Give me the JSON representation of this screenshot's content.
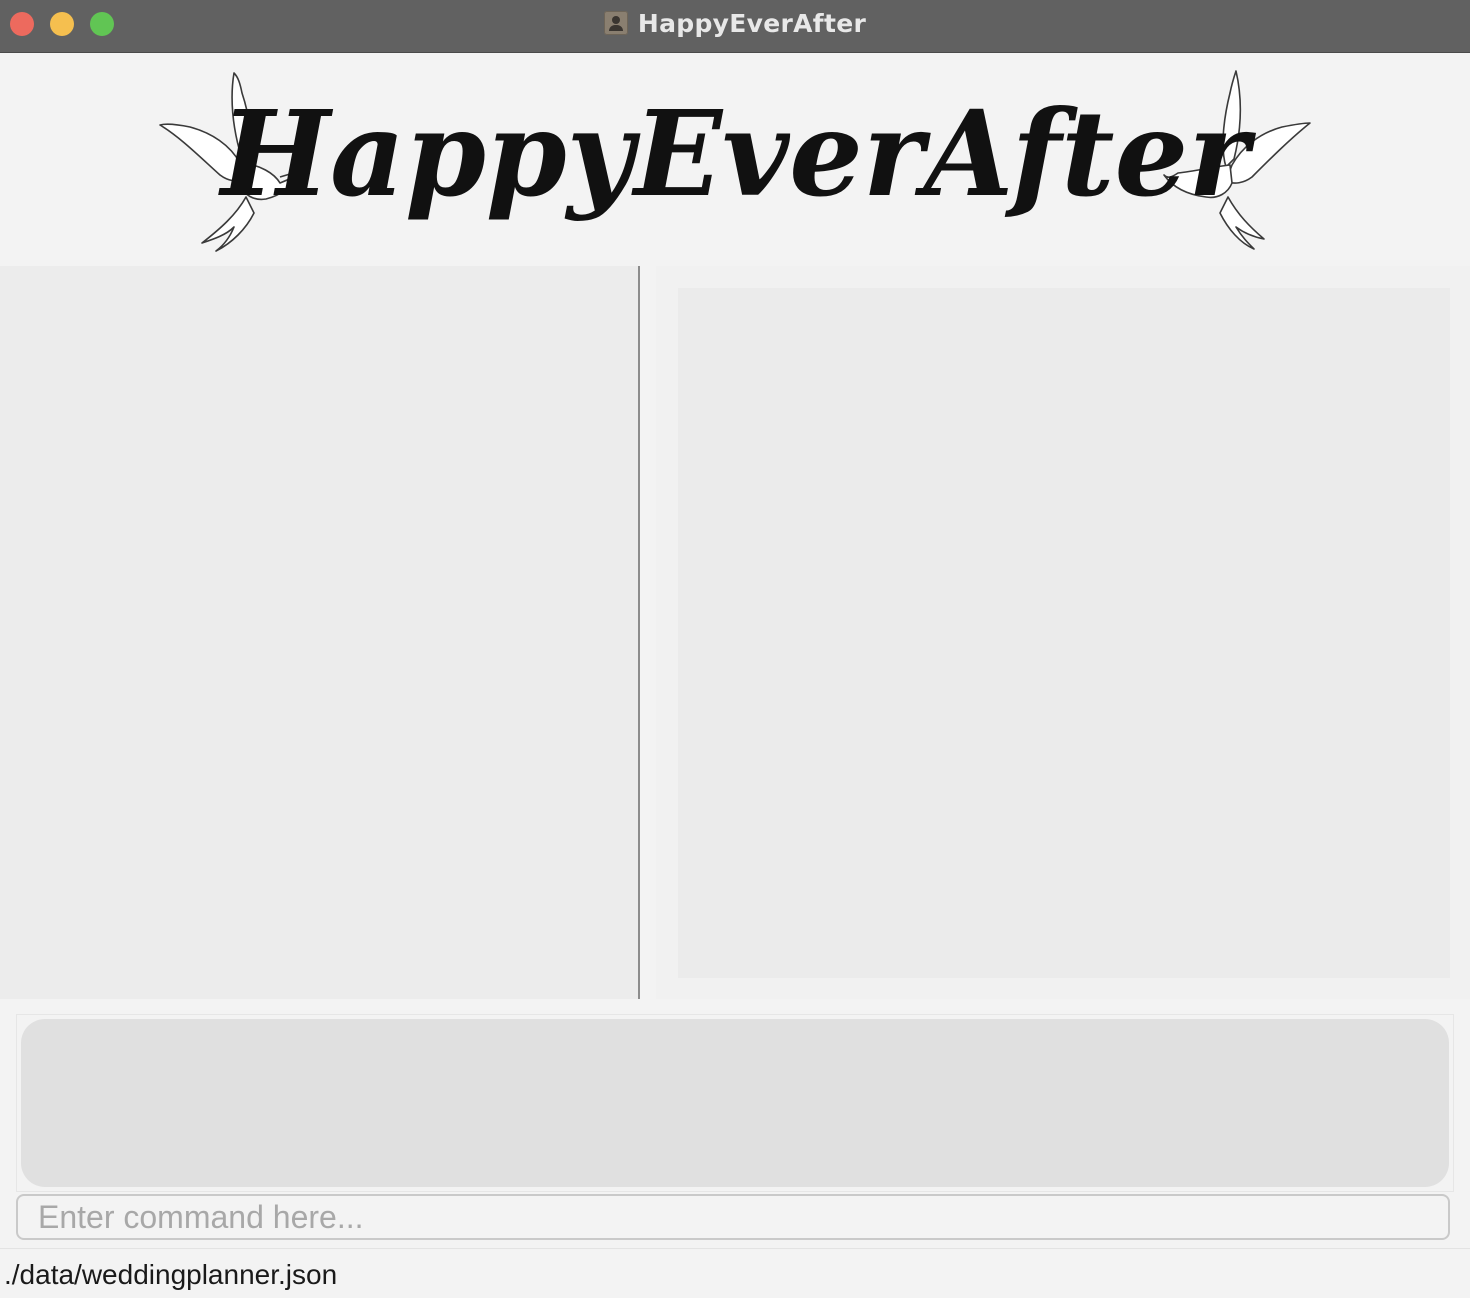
{
  "window": {
    "title": "HappyEverAfter"
  },
  "banner": {
    "logo_text": "HappyEverAfter"
  },
  "command": {
    "placeholder": "Enter command here...",
    "value": ""
  },
  "status": {
    "file_path": "./data/weddingplanner.json"
  },
  "colors": {
    "titlebar": "#616161",
    "close": "#ed6a5e",
    "minimize": "#f5bf4f",
    "maximize": "#61c554",
    "background": "#f3f3f3",
    "result_box": "#e0e0e0"
  }
}
